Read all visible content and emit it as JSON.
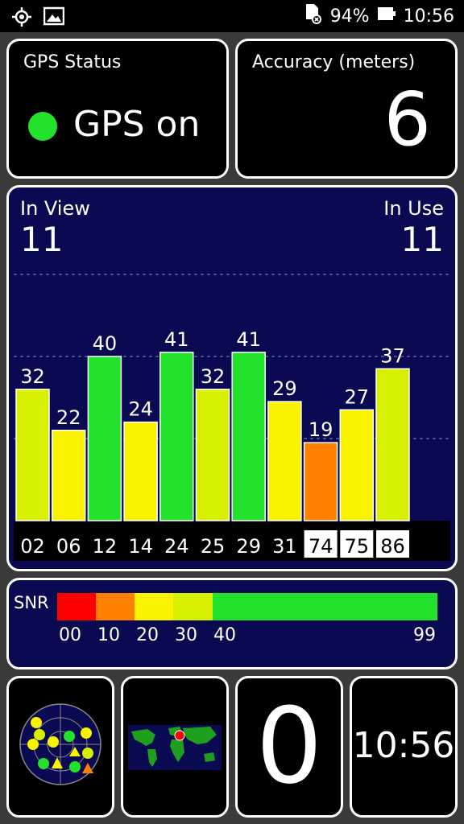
{
  "status_bar": {
    "battery": "94%",
    "time": "10:56"
  },
  "gps_status": {
    "title": "GPS Status",
    "state": "GPS on"
  },
  "accuracy": {
    "title": "Accuracy (meters)",
    "value": "6"
  },
  "satellites": {
    "in_view_label": "In View",
    "in_view_value": "11",
    "in_use_label": "In Use",
    "in_use_value": "11"
  },
  "chart_data": {
    "type": "bar",
    "categories": [
      "02",
      "06",
      "12",
      "14",
      "24",
      "25",
      "29",
      "31",
      "74",
      "75",
      "86"
    ],
    "values": [
      32,
      22,
      40,
      24,
      41,
      32,
      41,
      29,
      19,
      27,
      37
    ],
    "highlighted_labels": [
      "74",
      "75",
      "86"
    ],
    "ylim": [
      0,
      60
    ],
    "grid": true,
    "colors": [
      "#d6f000",
      "#fbf200",
      "#22e22b",
      "#fbf200",
      "#22e22b",
      "#d6f000",
      "#22e22b",
      "#fbf200",
      "#ff8000",
      "#fbf200",
      "#d6f000"
    ]
  },
  "snr": {
    "label": "SNR",
    "segments": [
      {
        "color": "#ff0000",
        "fraction": 0.102
      },
      {
        "color": "#ff8000",
        "fraction": 0.102
      },
      {
        "color": "#fbf200",
        "fraction": 0.102
      },
      {
        "color": "#d6f000",
        "fraction": 0.102
      },
      {
        "color": "#22e22b",
        "fraction": 0.592
      }
    ],
    "ticks": [
      "00",
      "10",
      "20",
      "30",
      "40",
      "99"
    ]
  },
  "bottom_tiles": {
    "zero_value": "0",
    "clock": "10:56"
  }
}
